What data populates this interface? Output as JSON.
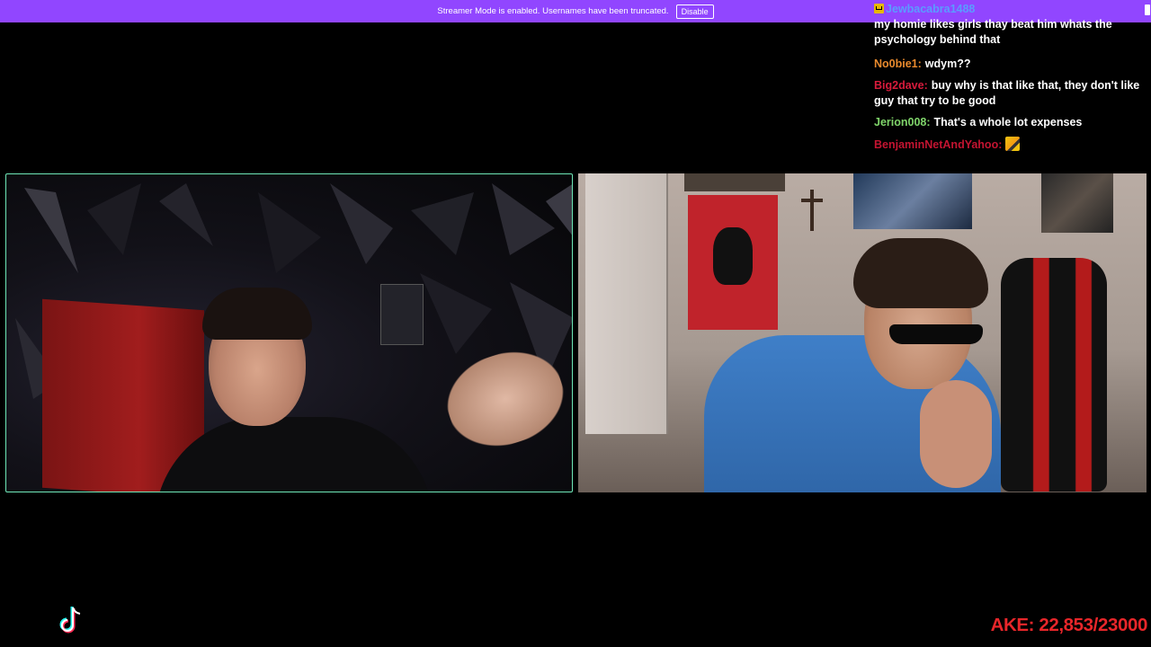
{
  "banner": {
    "text": "Streamer Mode is enabled. Usernames have been truncated.",
    "button_label": "Disable"
  },
  "chat": {
    "messages": [
      {
        "user": "Jewbacabra1488",
        "text": "my homie likes girls thay beat him whats the psychology behind that",
        "color": "#5b9bff",
        "badge": "crown-badge-icon"
      },
      {
        "user": "No0bie1:",
        "text": "wdym??",
        "color": "#e98a2d"
      },
      {
        "user": "Big2dave:",
        "text": "buy why is that like that, they don't like guy that try to be good",
        "color": "#d81b3c"
      },
      {
        "user": "Jerion008:",
        "text": "That's a whole lot expenses",
        "color": "#7fd46a"
      },
      {
        "user": "BenjaminNetAndYahoo:",
        "text": "",
        "color": "#c41431",
        "emote": "emote-icon"
      }
    ]
  },
  "counter": {
    "text": "AKE: 22,853/23000",
    "color": "#e8262a"
  },
  "colors": {
    "banner_bg": "#9146ff",
    "left_cam_border": "#6ee7b7"
  }
}
